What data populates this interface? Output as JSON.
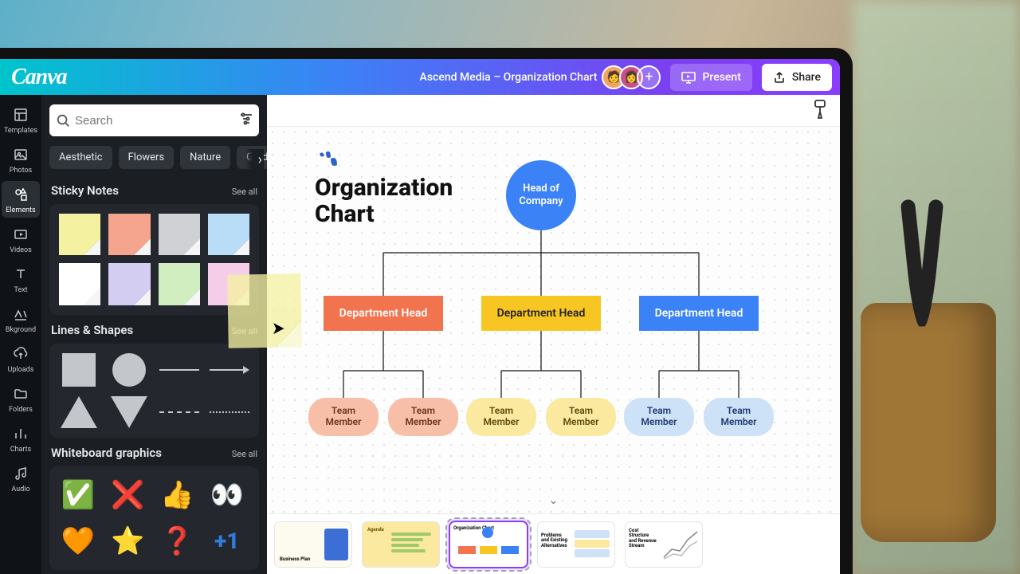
{
  "app": {
    "logo_text": "Canva"
  },
  "header": {
    "document_title": "Ascend Media – Organization Chart",
    "present_label": "Present",
    "share_label": "Share",
    "add_collaborator_glyph": "+"
  },
  "rail": {
    "items": [
      {
        "key": "templates",
        "label": "Templates"
      },
      {
        "key": "photos",
        "label": "Photos"
      },
      {
        "key": "elements",
        "label": "Elements",
        "active": true
      },
      {
        "key": "videos",
        "label": "Videos"
      },
      {
        "key": "text",
        "label": "Text"
      },
      {
        "key": "bkground",
        "label": "Bkground"
      },
      {
        "key": "uploads",
        "label": "Uploads"
      },
      {
        "key": "folders",
        "label": "Folders"
      },
      {
        "key": "charts",
        "label": "Charts"
      },
      {
        "key": "audio",
        "label": "Audio"
      }
    ]
  },
  "panel": {
    "search_placeholder": "Search",
    "chips": [
      "Aesthetic",
      "Flowers",
      "Nature",
      "Gradient"
    ],
    "see_all_label": "See all",
    "sections": {
      "sticky": {
        "title": "Sticky Notes"
      },
      "lines": {
        "title": "Lines & Shapes"
      },
      "whiteboard": {
        "title": "Whiteboard graphics"
      }
    },
    "sticky_colors": [
      "yellow",
      "coral",
      "gray",
      "blue",
      "white",
      "lav",
      "green",
      "pink"
    ]
  },
  "canvas": {
    "title_line1": "Organization",
    "title_line2": "Chart",
    "head_node": "Head of Company",
    "dept_label": "Department Head",
    "team_label": "Team Member",
    "colors": {
      "head": "#3b82f6",
      "dept_orange": "#f2744e",
      "dept_yellow": "#f7c623",
      "dept_blue": "#3b82f6"
    }
  },
  "filmstrip": {
    "slides": [
      {
        "caption": "Business Plan"
      },
      {
        "caption": "Agenda"
      },
      {
        "caption": "Organization Chart",
        "selected": true
      },
      {
        "caption": "Problems and Existing Alternatives"
      },
      {
        "caption": "Cost Structure and Revenue Stream"
      }
    ]
  }
}
